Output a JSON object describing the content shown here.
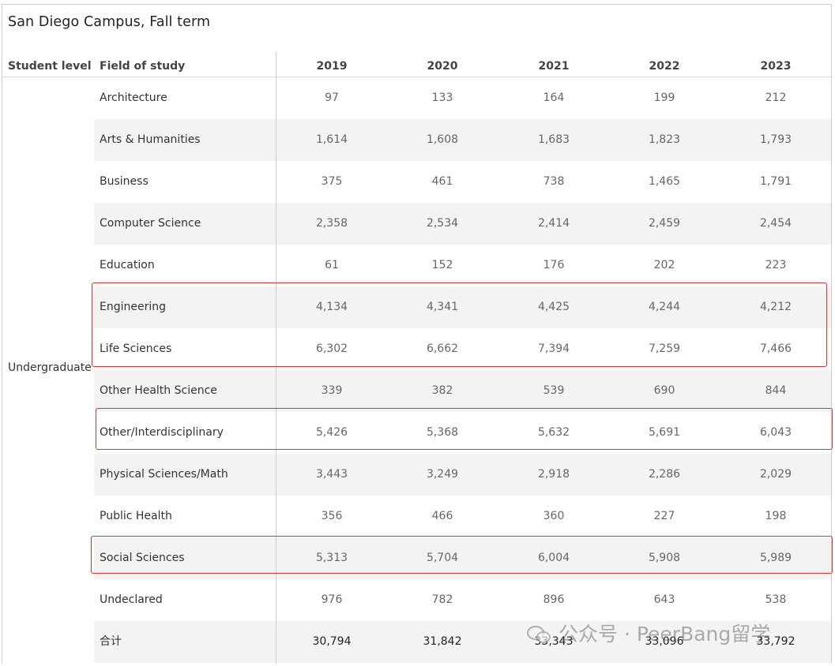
{
  "title": "San Diego Campus, Fall term",
  "headers": {
    "student_level": "Student level",
    "field_of_study": "Field of study",
    "years": [
      "2019",
      "2020",
      "2021",
      "2022",
      "2023"
    ]
  },
  "student_level": "Undergraduate",
  "rows": [
    {
      "field": "Architecture",
      "values": [
        "97",
        "133",
        "164",
        "199",
        "212"
      ]
    },
    {
      "field": "Arts & Humanities",
      "values": [
        "1,614",
        "1,608",
        "1,683",
        "1,823",
        "1,793"
      ]
    },
    {
      "field": "Business",
      "values": [
        "375",
        "461",
        "738",
        "1,465",
        "1,791"
      ]
    },
    {
      "field": "Computer Science",
      "values": [
        "2,358",
        "2,534",
        "2,414",
        "2,459",
        "2,454"
      ]
    },
    {
      "field": "Education",
      "values": [
        "61",
        "152",
        "176",
        "202",
        "223"
      ]
    },
    {
      "field": "Engineering",
      "values": [
        "4,134",
        "4,341",
        "4,425",
        "4,244",
        "4,212"
      ]
    },
    {
      "field": "Life Sciences",
      "values": [
        "6,302",
        "6,662",
        "7,394",
        "7,259",
        "7,466"
      ]
    },
    {
      "field": "Other Health Science",
      "values": [
        "339",
        "382",
        "539",
        "690",
        "844"
      ]
    },
    {
      "field": "Other/Interdisciplinary",
      "values": [
        "5,426",
        "5,368",
        "5,632",
        "5,691",
        "6,043"
      ]
    },
    {
      "field": "Physical Sciences/Math",
      "values": [
        "3,443",
        "3,249",
        "2,918",
        "2,286",
        "2,029"
      ]
    },
    {
      "field": "Public Health",
      "values": [
        "356",
        "466",
        "360",
        "227",
        "198"
      ]
    },
    {
      "field": "Social Sciences",
      "values": [
        "5,313",
        "5,704",
        "6,004",
        "5,908",
        "5,989"
      ]
    },
    {
      "field": "Undeclared",
      "values": [
        "976",
        "782",
        "896",
        "643",
        "538"
      ]
    }
  ],
  "total": {
    "field": "合计",
    "values": [
      "30,794",
      "31,842",
      "33,343",
      "33,096",
      "33,792"
    ]
  },
  "watermark": {
    "text": "公众号 · PeerBang留学",
    "icon": "wechat-icon"
  },
  "colors": {
    "highlight_box": "#e03030",
    "row_shade": "#f3f3f3"
  }
}
